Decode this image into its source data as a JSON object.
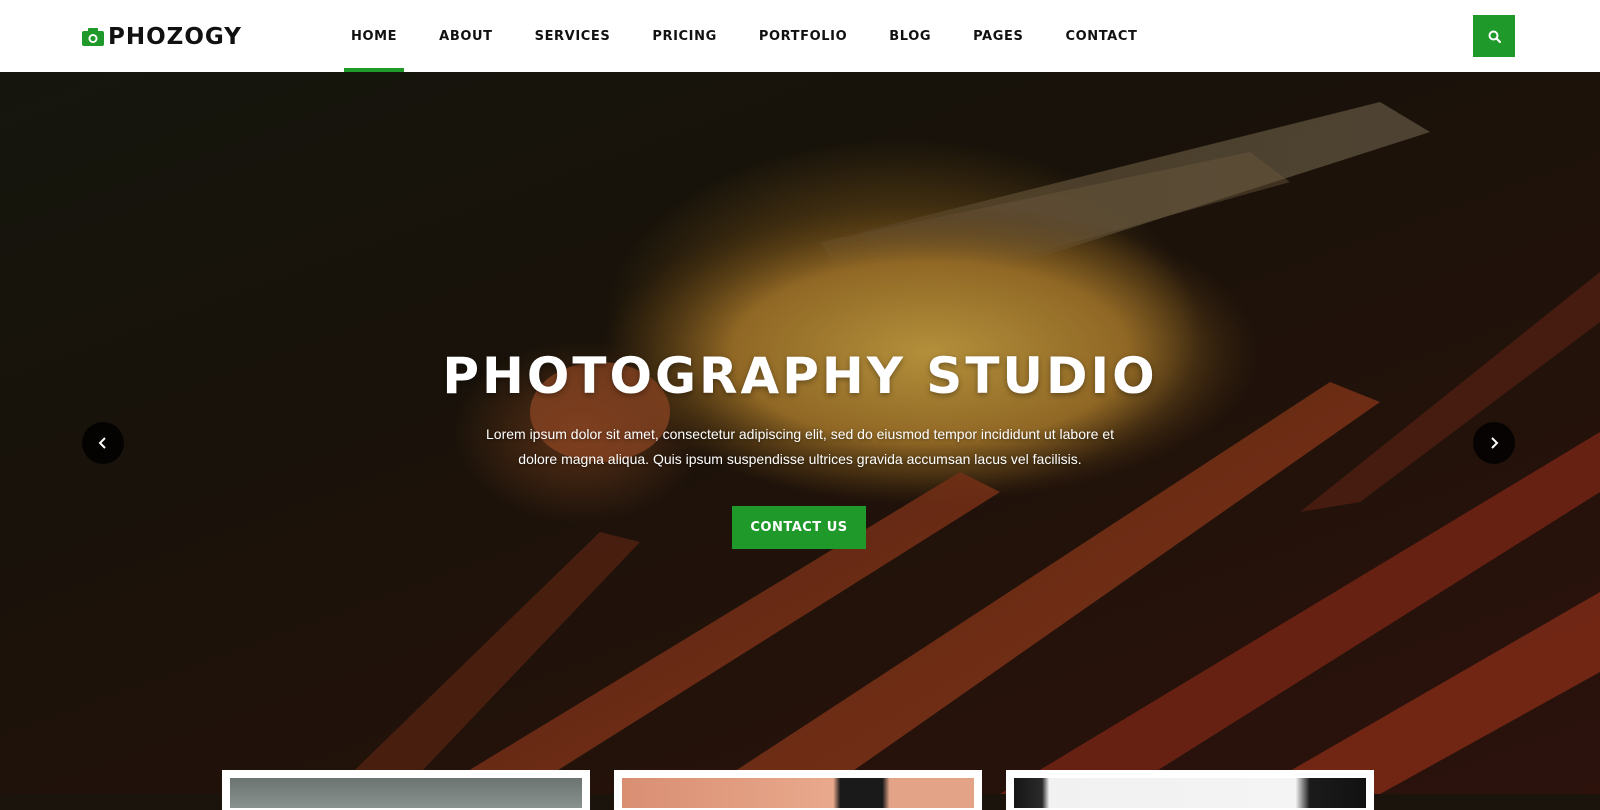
{
  "header": {
    "logo_text": "PHOZOGY",
    "logo_icon": "camera-icon",
    "nav": [
      {
        "label": "HOME",
        "active": true
      },
      {
        "label": "ABOUT",
        "active": false
      },
      {
        "label": "SERVICES",
        "active": false
      },
      {
        "label": "PRICING",
        "active": false
      },
      {
        "label": "PORTFOLIO",
        "active": false
      },
      {
        "label": "BLOG",
        "active": false
      },
      {
        "label": "PAGES",
        "active": false
      },
      {
        "label": "CONTACT",
        "active": false
      }
    ],
    "search_icon": "search-icon"
  },
  "hero": {
    "title": "PHOTOGRAPHY STUDIO",
    "text": "Lorem ipsum dolor sit amet, consectetur adipiscing elit, sed do eiusmod tempor incididunt ut labore et dolore magna aliqua. Quis ipsum suspendisse ultrices gravida accumsan lacus vel facilisis.",
    "cta_label": "CONTACT US",
    "prev_icon": "chevron-left-icon",
    "next_icon": "chevron-right-icon"
  },
  "colors": {
    "accent": "#1f9a2a",
    "text_dark": "#111111",
    "white": "#ffffff"
  }
}
